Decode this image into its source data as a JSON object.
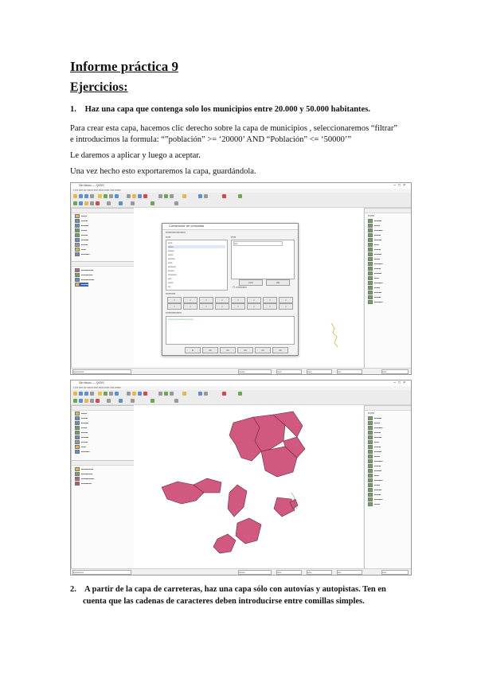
{
  "document": {
    "title": "Informe práctica 9",
    "section_heading": "Ejercicios:",
    "exercise1": {
      "number": "1.",
      "text": "Haz una capa que contenga solo los municipios entre 20.000 y 50.000 habitantes."
    },
    "paragraph1_line1": "Para crear esta capa, hacemos clic derecho sobre la capa de municipios , seleccionaremos “filtrar”",
    "paragraph1_line2": "e introducimos la formula: “”población” >= ‘20000’ AND “Población” <= ‘50000’”",
    "paragraph2": "Le daremos a aplicar y luego a aceptar.",
    "paragraph3": "Una vez hecho esto exportaremos la capa, guardándola.",
    "exercise2": {
      "number": "2.",
      "line1": "A partir de la capa de carreteras, haz una capa sólo con autovías y autopistas. Ten en",
      "line2": "cuenta que las cadenas de caracteres deben introducirse entre comillas simples."
    }
  },
  "screenshot1": {
    "window_title": "Sin título — QGIS",
    "dialog_title": "Constructor de consultas"
  },
  "screenshot2": {
    "window_title": "Sin título — QGIS"
  },
  "colors": {
    "municipio_fill": "#d1587f",
    "municipio_stroke": "#6a2a40"
  }
}
